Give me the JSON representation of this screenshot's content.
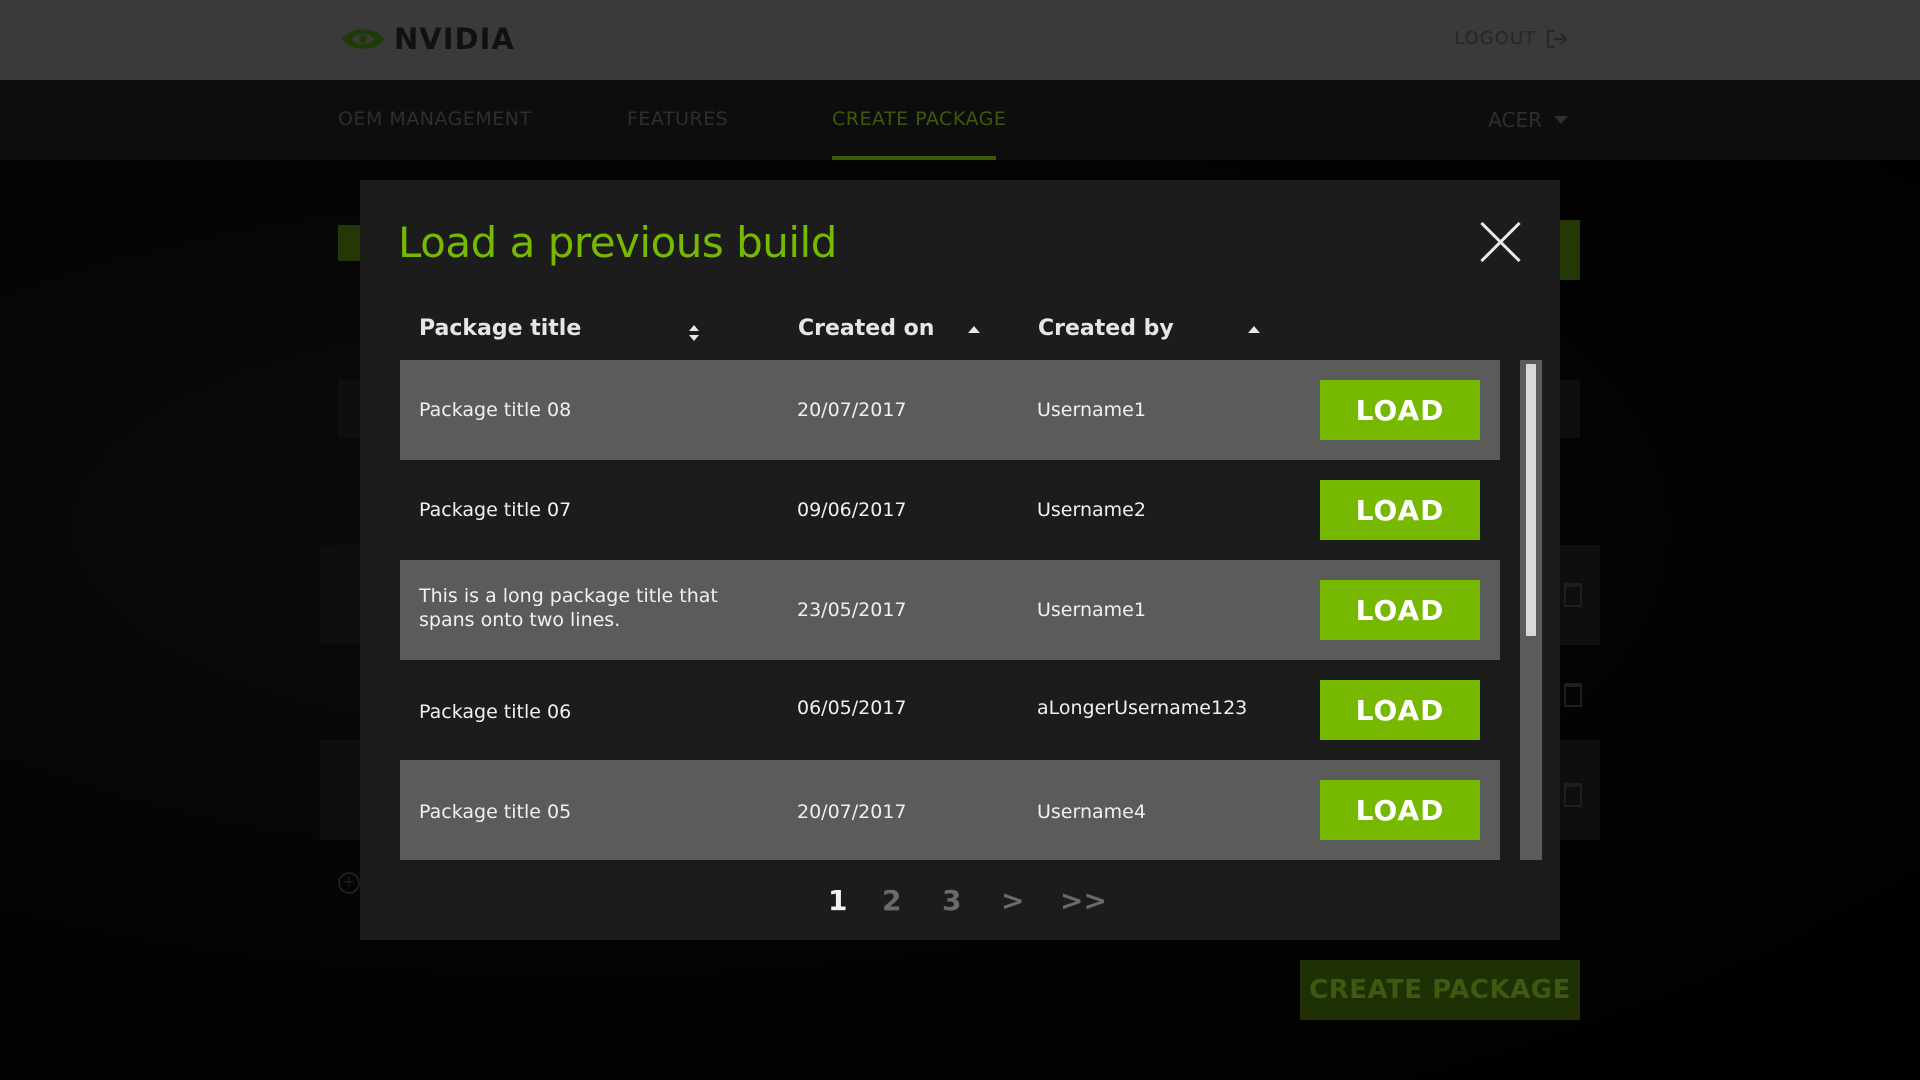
{
  "header": {
    "logo_text": "NVIDIA",
    "logout_label": "LOGOUT"
  },
  "nav": {
    "items": [
      {
        "label": "OEM MANAGEMENT"
      },
      {
        "label": "FEATURES"
      },
      {
        "label": "CREATE PACKAGE",
        "active": true
      }
    ],
    "account": "ACER"
  },
  "background": {
    "create_package_label": "CREATE PACKAGE"
  },
  "modal": {
    "title": "Load a previous build",
    "columns": [
      {
        "label": "Package title",
        "sort": "both"
      },
      {
        "label": "Created on",
        "sort": "asc"
      },
      {
        "label": "Created by",
        "sort": "asc"
      }
    ],
    "rows": [
      {
        "title": "Package title 08",
        "date": "20/07/2017",
        "user": "Username1",
        "action": "LOAD"
      },
      {
        "title": "Package title 07",
        "date": "09/06/2017",
        "user": "Username2",
        "action": "LOAD"
      },
      {
        "title": "This is a long package title that spans onto two lines.",
        "date": "23/05/2017",
        "user": "Username1",
        "action": "LOAD"
      },
      {
        "title": "Package title 06",
        "date": "06/05/2017",
        "user": "aLongerUsername123",
        "action": "LOAD"
      },
      {
        "title": "Package title 05",
        "date": "20/07/2017",
        "user": "Username4",
        "action": "LOAD"
      }
    ],
    "pagination": {
      "pages": [
        "1",
        "2",
        "3"
      ],
      "current": "1",
      "next": ">",
      "last": ">>"
    }
  },
  "colors": {
    "accent": "#76b900",
    "modal_bg": "#1c1c1c",
    "row_shaded": "#5b5b5b"
  }
}
